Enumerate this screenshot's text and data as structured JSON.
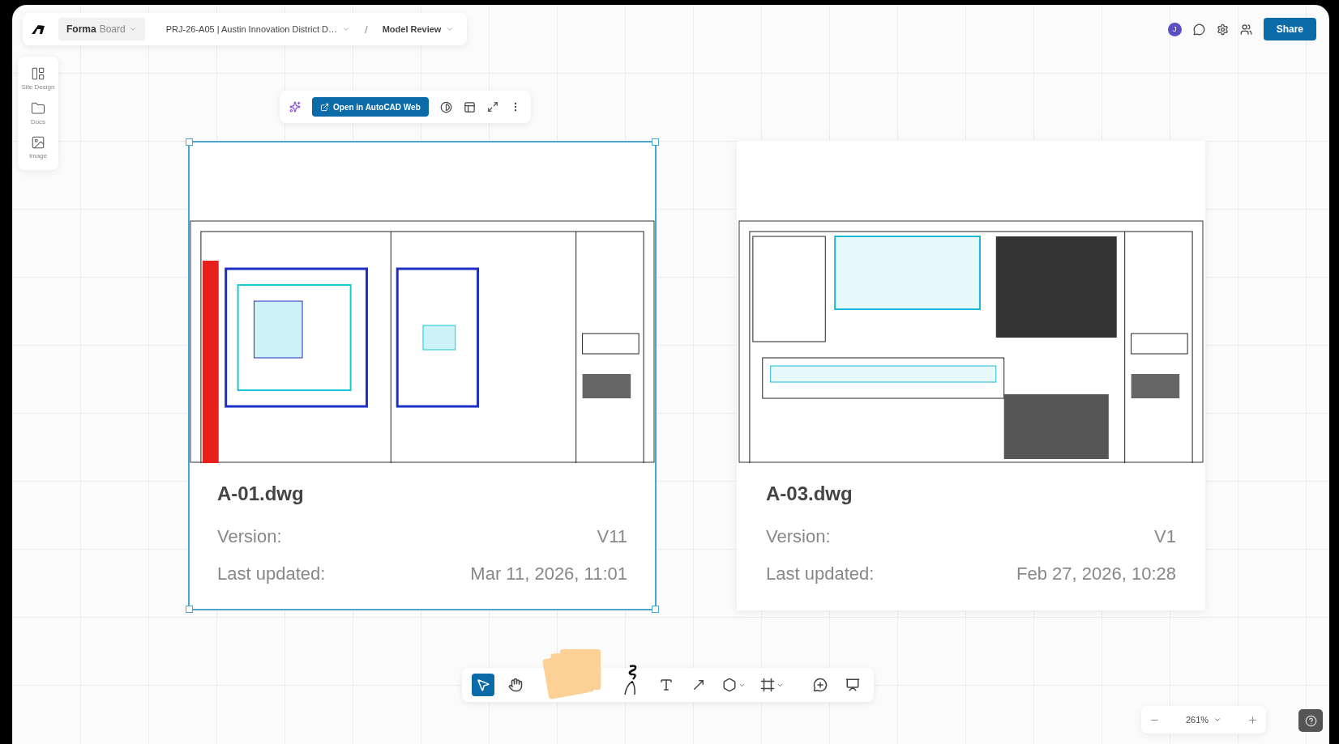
{
  "breadcrumb": {
    "brand": "Forma",
    "product": "Board",
    "project": "PRJ-26-A05 | Austin Innovation District D…",
    "separator": "/",
    "view": "Model Review"
  },
  "header": {
    "avatar": "J",
    "share": "Share"
  },
  "sidebar": {
    "items": [
      {
        "kind": "layout",
        "label": "Site Design"
      },
      {
        "kind": "folder",
        "label": "Docs"
      },
      {
        "kind": "image",
        "label": "Image"
      }
    ]
  },
  "context_toolbar": {
    "primary": "Open in AutoCAD Web"
  },
  "cards": [
    {
      "title": "A-01.dwg",
      "selected": true,
      "fields": [
        {
          "label": "Version:",
          "value": "V11"
        },
        {
          "label": "Last updated:",
          "value": "Mar 11, 2026, 11:01"
        }
      ]
    },
    {
      "title": "A-03.dwg",
      "selected": false,
      "fields": [
        {
          "label": "Version:",
          "value": "V1"
        },
        {
          "label": "Last updated:",
          "value": "Feb 27, 2026, 10:28"
        }
      ]
    }
  ],
  "tools": [
    {
      "kind": "select",
      "selected": true
    },
    {
      "kind": "hand",
      "selected": false
    },
    {
      "kind": "sticky",
      "selected": false
    },
    {
      "kind": "pen",
      "selected": false
    },
    {
      "kind": "text",
      "selected": false
    },
    {
      "kind": "arrow",
      "selected": false
    },
    {
      "kind": "shape",
      "selected": false
    },
    {
      "kind": "frame",
      "selected": false
    },
    {
      "kind": "comment",
      "selected": false
    },
    {
      "kind": "present",
      "selected": false
    }
  ],
  "zoom": {
    "value": "261%"
  }
}
